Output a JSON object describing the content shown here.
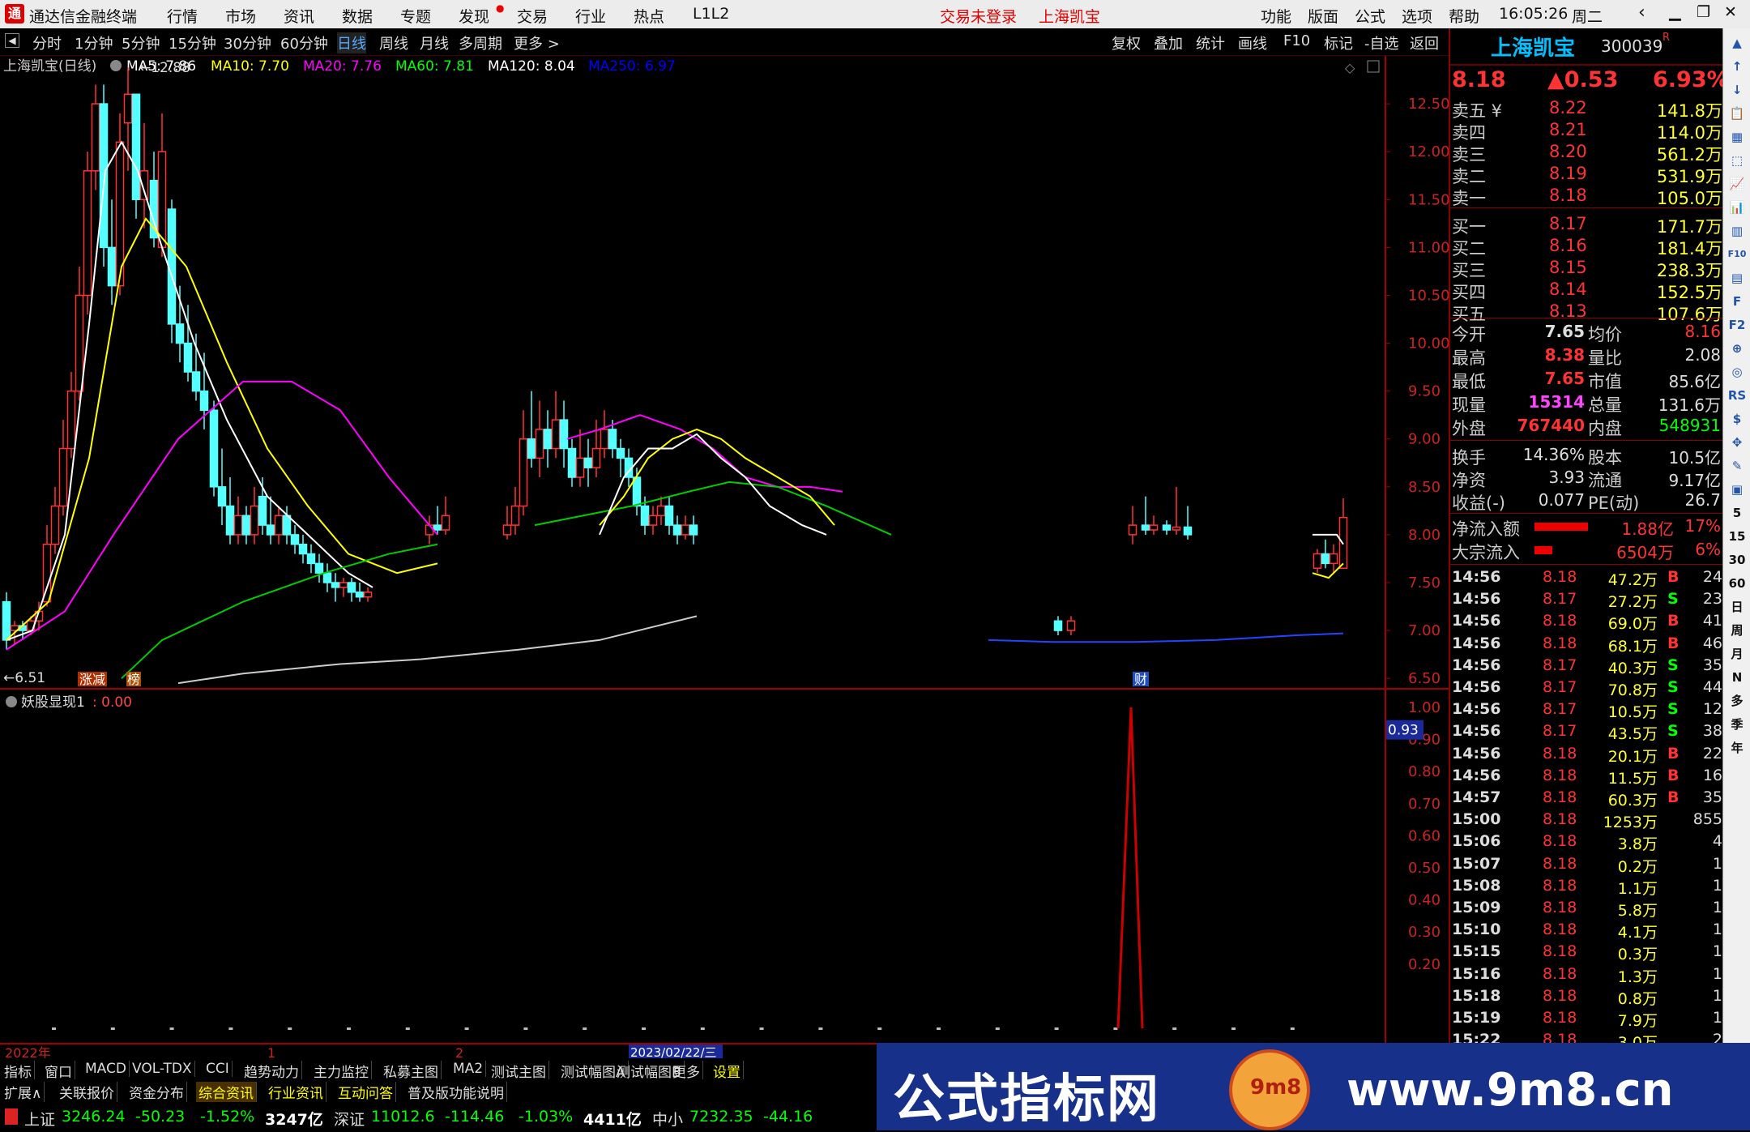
{
  "app": {
    "name": "通达信金融终端",
    "menus": [
      "行情",
      "市场",
      "资讯",
      "数据",
      "专题",
      "发现",
      "交易",
      "行业",
      "热点",
      "L1L2"
    ],
    "login_status": "交易未登录",
    "stock_tab": "上海凯宝",
    "right_menus": [
      "功能",
      "版面",
      "公式",
      "选项",
      "帮助"
    ],
    "time": "16:05:26",
    "weekday": "周二"
  },
  "toolbar": {
    "periods": [
      "分时",
      "1分钟",
      "5分钟",
      "15分钟",
      "30分钟",
      "60分钟",
      "日线",
      "周线",
      "月线",
      "多周期",
      "更多 >"
    ],
    "active": "日线",
    "right_buttons": [
      "复权",
      "叠加",
      "统计",
      "画线",
      "F10",
      "标记",
      "-自选",
      "返回"
    ]
  },
  "chart": {
    "title": "上海凯宝(日线)",
    "ma_labels": [
      {
        "text": "MA5: 7.86",
        "color": "#ffffff"
      },
      {
        "text": "MA10: 7.70",
        "color": "#ffff00"
      },
      {
        "text": "MA20: 7.76",
        "color": "#ff00ff"
      },
      {
        "text": "MA60: 7.81",
        "color": "#00ff00"
      },
      {
        "text": "MA120: 8.04",
        "color": "#ffffff"
      },
      {
        "text": "MA250: 6.97",
        "color": "#0000ff"
      }
    ],
    "price_axis": [
      "12.50",
      "12.00",
      "11.50",
      "11.00",
      "10.50",
      "10.00",
      "9.50",
      "9.00",
      "8.50",
      "8.00",
      "7.50",
      "7.00",
      "6.50"
    ],
    "high_label": "12.88",
    "low_label": "6.51",
    "markers": {
      "zhangjian": "涨减",
      "bang": "榜",
      "cai": "财"
    },
    "indicator_title": "妖股显现1",
    "indicator_value": ": 0.00",
    "ind_axis": [
      "1.00",
      "0.90",
      "0.80",
      "0.70",
      "0.60",
      "0.50",
      "0.40",
      "0.30",
      "0.20"
    ],
    "ind_current": "0.93",
    "x_labels": [
      "2022年",
      "1",
      "2"
    ],
    "cursor_date": "2023/02/22/三"
  },
  "chart_data": {
    "type": "candlestick",
    "ylim": [
      6.4,
      13.0
    ],
    "x_labels": [
      "2022年",
      "1",
      "2"
    ],
    "high": 12.88,
    "low": 6.51
  },
  "quote": {
    "name": "上海凯宝",
    "code": "300039",
    "badge": "R",
    "price": "8.18",
    "change": "▲0.53",
    "pct": "6.93%",
    "asks": [
      [
        "卖五 ¥",
        "8.22",
        "141.8万"
      ],
      [
        "卖四",
        "8.21",
        "114.0万"
      ],
      [
        "卖三",
        "8.20",
        "561.2万"
      ],
      [
        "卖二",
        "8.19",
        "531.9万"
      ],
      [
        "卖一",
        "8.18",
        "105.0万"
      ]
    ],
    "bids": [
      [
        "买一",
        "8.17",
        "171.7万"
      ],
      [
        "买二",
        "8.16",
        "181.4万"
      ],
      [
        "买三",
        "8.15",
        "238.3万"
      ],
      [
        "买四",
        "8.14",
        "152.5万"
      ],
      [
        "买五",
        "8.13",
        "107.6万"
      ]
    ],
    "stats": [
      [
        "今开",
        "7.65",
        "均价",
        "8.16"
      ],
      [
        "最高",
        "8.38",
        "量比",
        "2.08"
      ],
      [
        "最低",
        "7.65",
        "市值",
        "85.6亿"
      ],
      [
        "现量",
        "15314",
        "总量",
        "131.6万"
      ],
      [
        "外盘",
        "767440",
        "内盘",
        "548931"
      ]
    ],
    "stats2": [
      [
        "换手",
        "14.36%",
        "股本",
        "10.5亿"
      ],
      [
        "净资",
        "3.93",
        "流通",
        "9.17亿"
      ],
      [
        "收益(-)",
        "0.077",
        "PE(动)",
        "26.7"
      ]
    ],
    "flows": [
      [
        "净流入额",
        "1.88亿",
        "17%"
      ],
      [
        "大宗流入",
        "6504万",
        "6%"
      ]
    ],
    "ticks": [
      [
        "14:56",
        "8.18",
        "47.2万",
        "B",
        "24"
      ],
      [
        "14:56",
        "8.17",
        "27.2万",
        "S",
        "23"
      ],
      [
        "14:56",
        "8.18",
        "69.0万",
        "B",
        "41"
      ],
      [
        "14:56",
        "8.18",
        "68.1万",
        "B",
        "46"
      ],
      [
        "14:56",
        "8.17",
        "40.3万",
        "S",
        "35"
      ],
      [
        "14:56",
        "8.17",
        "70.8万",
        "S",
        "44"
      ],
      [
        "14:56",
        "8.17",
        "10.5万",
        "S",
        "12"
      ],
      [
        "14:56",
        "8.17",
        "43.5万",
        "S",
        "38"
      ],
      [
        "14:56",
        "8.18",
        "20.1万",
        "B",
        "22"
      ],
      [
        "14:56",
        "8.18",
        "11.5万",
        "B",
        "16"
      ],
      [
        "14:57",
        "8.18",
        "60.3万",
        "B",
        "35"
      ],
      [
        "15:00",
        "8.18",
        "1253万",
        "",
        "855"
      ],
      [
        "15:06",
        "8.18",
        "3.8万",
        "",
        "4"
      ],
      [
        "15:07",
        "8.18",
        "0.2万",
        "",
        "1"
      ],
      [
        "15:08",
        "8.18",
        "1.1万",
        "",
        "1"
      ],
      [
        "15:09",
        "8.18",
        "5.8万",
        "",
        "1"
      ],
      [
        "15:10",
        "8.18",
        "4.1万",
        "",
        "1"
      ],
      [
        "15:15",
        "8.18",
        "0.3万",
        "",
        "1"
      ],
      [
        "15:16",
        "8.18",
        "1.3万",
        "",
        "1"
      ],
      [
        "15:18",
        "8.18",
        "0.8万",
        "",
        "1"
      ],
      [
        "15:19",
        "8.18",
        "7.9万",
        "",
        "1"
      ],
      [
        "15:22",
        "8.18",
        "3.0万",
        "",
        "2"
      ]
    ]
  },
  "side_icons": [
    "▲",
    "↑",
    "↓",
    "📋",
    "▦",
    "⬚",
    "📈",
    "📊",
    "▥",
    "F10",
    "▤",
    "F",
    "F2",
    "⊕",
    "◎",
    "RS",
    "$",
    "✥",
    "✎",
    "▣",
    "5",
    "15",
    "30",
    "60",
    "日",
    "周",
    "月",
    "N",
    "多",
    "季",
    "年"
  ],
  "bottom1": [
    "指标",
    "窗口",
    "MACD",
    "VOL-TDX",
    "CCI",
    "趋势动力",
    "主力监控",
    "私募主图",
    "MA2",
    "测试主图",
    "测试幅图A",
    "测试幅图B",
    "更多",
    "设置"
  ],
  "bottom2": [
    "扩展∧",
    "关联报价",
    "资金分布",
    "综合资讯",
    "行业资讯",
    "互动问答",
    "普及版功能说明"
  ],
  "status": [
    {
      "name": "上证",
      "value": "3246.24",
      "chg": "-50.23",
      "pct": "-1.52%",
      "amt": "3247亿"
    },
    {
      "name": "深证",
      "value": "11012.6",
      "chg": "-114.46",
      "pct": "-1.03%",
      "amt": "4411亿"
    },
    {
      "name": "中小",
      "value": "7232.35",
      "chg": "-44.16",
      "pct": "",
      "amt": ""
    }
  ],
  "banner": {
    "title": "公式指标网",
    "url": "www.9m8.cn",
    "coin_text": "9m8"
  }
}
